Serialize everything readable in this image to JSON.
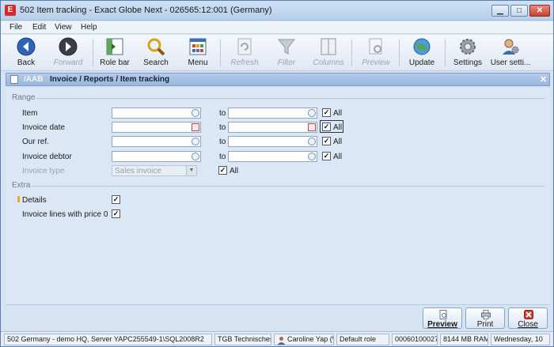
{
  "window": {
    "app_icon_letter": "E",
    "title": "502 Item tracking - Exact Globe Next - 026565:12:001 (Germany)",
    "min_glyph": "▁",
    "max_glyph": "□",
    "close_glyph": "✕"
  },
  "menu": [
    "File",
    "Edit",
    "View",
    "Help"
  ],
  "toolbar": {
    "back": "Back",
    "forward": "Forward",
    "role_bar": "Role bar",
    "search": "Search",
    "menu": "Menu",
    "refresh": "Refresh",
    "filter": "Filter",
    "columns": "Columns",
    "preview": "Preview",
    "update": "Update",
    "settings": "Settings",
    "user_settings": "User setti..."
  },
  "breadcrumb": {
    "code": "/AAB",
    "path": "Invoice / Reports / Item tracking",
    "close_glyph": "✕"
  },
  "range": {
    "title": "Range",
    "to_label": "to",
    "all_label": "All",
    "check_glyph": "✓",
    "item_label": "Item",
    "invoice_date_label": "Invoice date",
    "our_ref_label": "Our ref.",
    "invoice_debtor_label": "Invoice debtor",
    "invoice_type_label": "Invoice type",
    "invoice_type_value": "Sales invoice",
    "dropdown_glyph": "▼"
  },
  "extra": {
    "title": "Extra",
    "details_label": "Details",
    "invoice_lines_label": "Invoice lines with price 0"
  },
  "actions": {
    "preview": "Preview",
    "print": "Print",
    "close": "Close"
  },
  "status": {
    "server": "502 Germany - demo HQ, Server YAPC255549-1\\SQL2008R2",
    "company": "TGB Technisches",
    "user": "Caroline Yap (\\",
    "role": "Default role",
    "id": "00060100027",
    "ram": "8144 MB RAM",
    "date": "Wednesday, 10"
  },
  "colors": {
    "accent": "#9ab7de",
    "close_red": "#c6412d"
  }
}
